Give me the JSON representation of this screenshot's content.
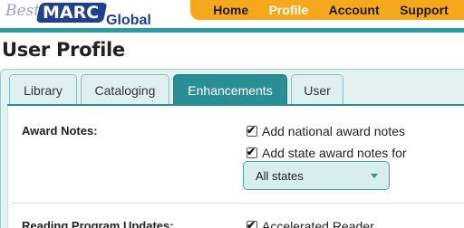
{
  "brand": {
    "best": "Best",
    "marc": "MARC",
    "tm": "™",
    "global": "Global"
  },
  "nav": {
    "items": [
      {
        "label": "Home",
        "active": false
      },
      {
        "label": "Profile",
        "active": true
      },
      {
        "label": "Account",
        "active": false
      },
      {
        "label": "Support",
        "active": false
      }
    ]
  },
  "page": {
    "title": "User Profile"
  },
  "tabs": [
    {
      "label": "Library",
      "active": false
    },
    {
      "label": "Cataloging",
      "active": false
    },
    {
      "label": "Enhancements",
      "active": true
    },
    {
      "label": "User",
      "active": false
    }
  ],
  "award_notes": {
    "label": "Award Notes:",
    "national": {
      "label": "Add national award notes",
      "checked": true
    },
    "state": {
      "label": "Add state award notes for",
      "checked": true
    },
    "states_select": {
      "value": "All states"
    }
  },
  "reading_program": {
    "label": "Reading Program Updates:",
    "accelerated": {
      "label": "Accelerated Reader",
      "checked": true
    }
  },
  "colors": {
    "nav_bg": "#f6a81c",
    "teal": "#2a8f95",
    "brand_blue": "#1f3f8f"
  }
}
